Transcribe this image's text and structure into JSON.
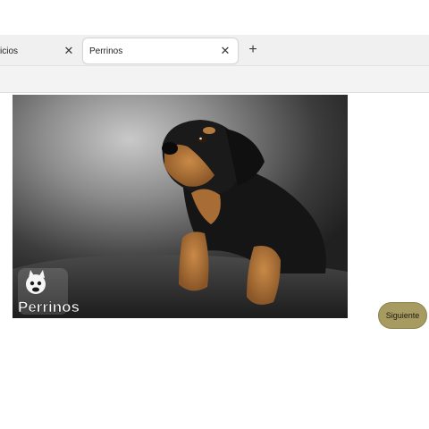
{
  "browser": {
    "tabs": [
      {
        "label": "icios",
        "close_icon": "close-icon",
        "active": false
      },
      {
        "label": "Perrinos",
        "close_icon": "close-icon",
        "active": true
      }
    ],
    "new_tab_icon": "plus-icon"
  },
  "page": {
    "image": {
      "subject": "rottweiler-puppy-photo",
      "watermark_text": "Perrinos"
    },
    "next_button_label": "Siguiente"
  },
  "colors": {
    "button_bg": "#a79b62",
    "tabstrip_bg": "#f0f0f0",
    "toolbar_bg": "#f3f3f3"
  }
}
